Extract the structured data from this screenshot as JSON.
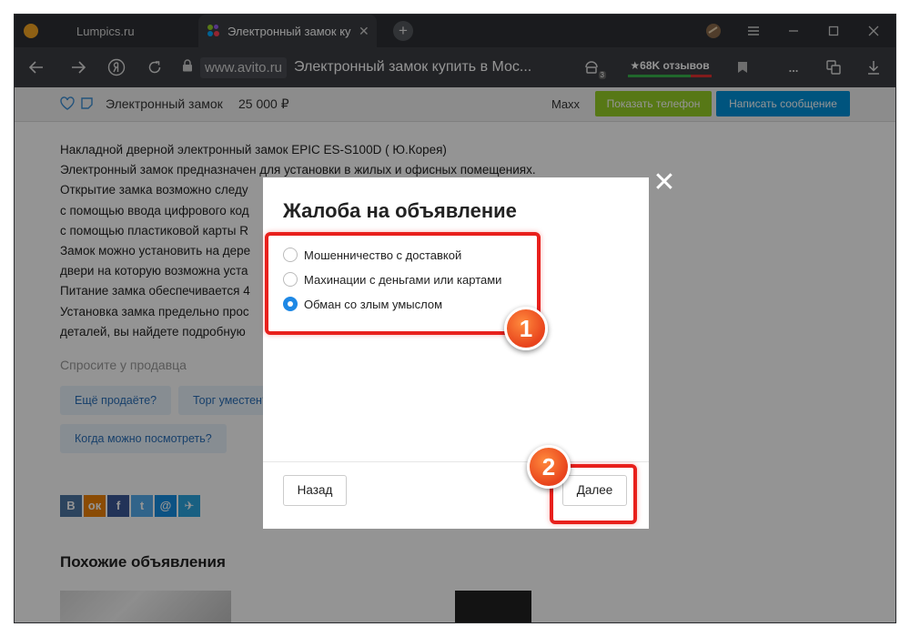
{
  "browser": {
    "tabs": [
      {
        "label": "Lumpics.ru",
        "active": false
      },
      {
        "label": "Электронный замок ку",
        "active": true
      }
    ],
    "tab_close_glyph": "✕",
    "new_tab_glyph": "+",
    "address": {
      "domain": "www.avito.ru",
      "page_title": "Электронный замок купить в Мос..."
    },
    "reviews_label": "★68K отзывов",
    "extension_badge": "3",
    "menu_glyph": "...",
    "icons": [
      "back-arrow-icon",
      "forward-arrow-icon",
      "yandex-logo-icon",
      "reload-icon",
      "lock-icon",
      "extension-icon",
      "bookmark-icon",
      "more-icon",
      "translate-icon",
      "download-icon",
      "menu-icon",
      "minimize-icon",
      "maximize-icon",
      "close-icon"
    ]
  },
  "listing": {
    "title": "Электронный замок",
    "price": "25 000 ₽",
    "seller": "Maxx",
    "show_phone_label": "Показать телефон",
    "write_message_label": "Написать сообщение",
    "description_lines": [
      "Накладной  дверной электронный замок EPIC ES-S100D ( Ю.Корея)",
      "Электронный замок предназначен для установки в жилых и офисных помещениях.",
      "Открытие замка возможно следу",
      " с помощью ввода цифрового код",
      " с помощью пластиковой карты R",
      "Замок можно установить на дере",
      "двери на которую возможна уста",
      "Питание замка обеспечивается 4",
      "Установка замка предельно прос",
      "деталей, вы найдете подробную"
    ],
    "ask_seller_heading": "Спросите у продавца",
    "ask_chips": [
      "Ещё продаёте?",
      "Торг уместен?",
      "Когда можно посмотреть?"
    ],
    "share_buttons": [
      {
        "label": "В",
        "color": "#4c75a3"
      },
      {
        "label": "ок",
        "color": "#ee8208"
      },
      {
        "label": "f",
        "color": "#3b5998"
      },
      {
        "label": "t",
        "color": "#55acee"
      },
      {
        "label": "@",
        "color": "#168de2"
      },
      {
        "label": "✈",
        "color": "#2ca5e0"
      }
    ],
    "similar_heading": "Похожие объявления"
  },
  "modal": {
    "title": "Жалоба на объявление",
    "options": [
      {
        "label": "Мошенничество с доставкой",
        "checked": false
      },
      {
        "label": "Махинации с деньгами или картами",
        "checked": false
      },
      {
        "label": "Обман со злым умыслом",
        "checked": true
      }
    ],
    "back_label": "Назад",
    "next_label": "Далее",
    "close_glyph": "✕"
  },
  "annotations": {
    "step1": "1",
    "step2": "2",
    "highlight_color": "#e8201c",
    "badge_color": "#f26522"
  }
}
